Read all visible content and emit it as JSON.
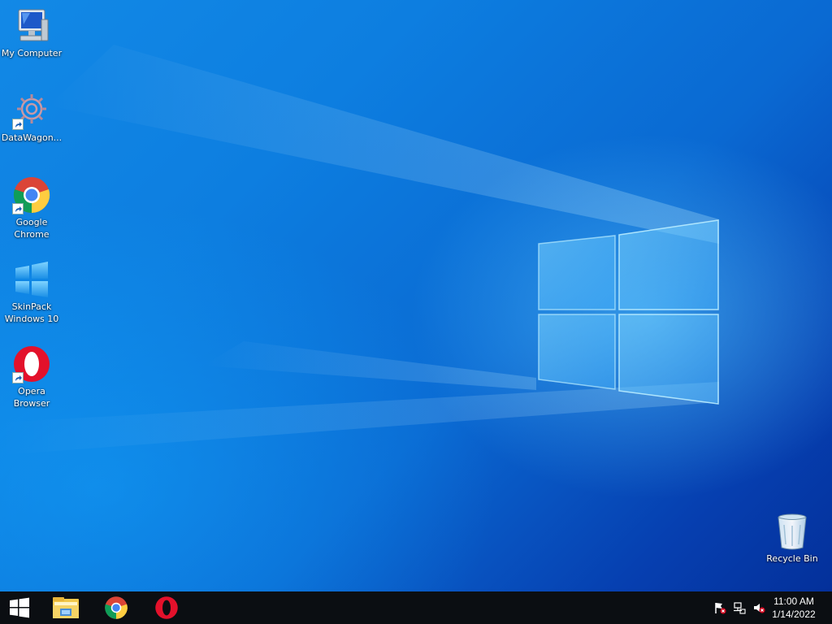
{
  "desktop": {
    "icons": [
      {
        "label": "My Computer",
        "icon": "computer-icon",
        "shortcut": false
      },
      {
        "label": "DataWagon...",
        "icon": "datawagon-icon",
        "shortcut": true
      },
      {
        "label": "Google\nChrome",
        "icon": "chrome-icon",
        "shortcut": true
      },
      {
        "label": "SkinPack\nWindows 10",
        "icon": "windows-logo-icon",
        "shortcut": false
      },
      {
        "label": "Opera\nBrowser",
        "icon": "opera-icon",
        "shortcut": true
      },
      {
        "label": "Recycle Bin",
        "icon": "recycle-bin-icon",
        "shortcut": false
      }
    ]
  },
  "taskbar": {
    "start_icon": "windows-start-icon",
    "pinned": [
      {
        "name": "File Explorer",
        "icon": "file-explorer-icon"
      },
      {
        "name": "Google Chrome",
        "icon": "chrome-icon"
      },
      {
        "name": "Opera Browser",
        "icon": "opera-icon"
      }
    ],
    "tray": {
      "icons": [
        "action-center-flag-icon",
        "network-icon",
        "volume-muted-icon"
      ],
      "time": "11:00 AM",
      "date": "1/14/2022"
    }
  },
  "colors": {
    "wallpaper_blue": "#0a69d2",
    "taskbar": "#0b0e12",
    "text": "#ffffff"
  }
}
